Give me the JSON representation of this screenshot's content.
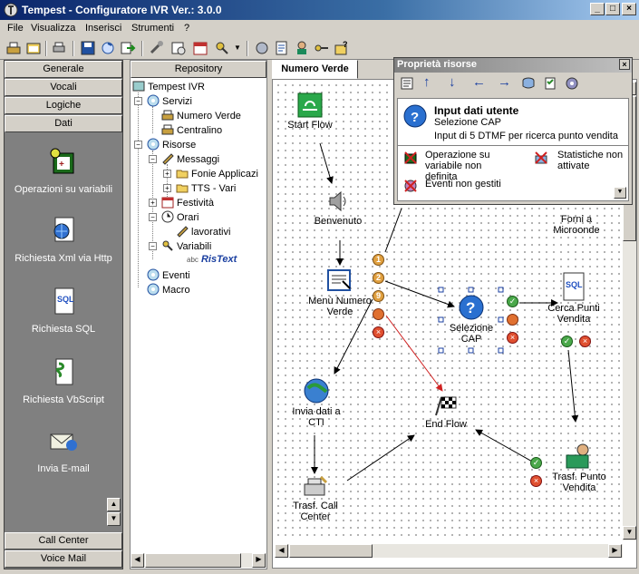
{
  "window": {
    "title": "Tempest - Configuratore IVR Ver.: 3.0.0"
  },
  "menu": [
    "File",
    "Visualizza",
    "Inserisci",
    "Strumenti",
    "?"
  ],
  "left_panel": {
    "categories_top": [
      "Generale",
      "Vocali",
      "Logiche",
      "Dati"
    ],
    "items": [
      "Operazioni su variabili",
      "Richiesta Xml via Http",
      "Richiesta SQL",
      "Richiesta VbScript",
      "Invia E-mail"
    ],
    "categories_bottom": [
      "Call Center",
      "Voice Mail"
    ]
  },
  "repository": {
    "header": "Repository",
    "nodes": {
      "root": "Tempest IVR",
      "servizi": "Servizi",
      "numero_verde": "Numero Verde",
      "centralino": "Centralino",
      "risorse": "Risorse",
      "messaggi": "Messaggi",
      "fonie": "Fonie Applicazi",
      "tts": "TTS - Vari",
      "festivita": "Festività",
      "orari": "Orari",
      "lavorativi": "lavorativi",
      "variabili": "Variabili",
      "ristext": "RisText",
      "ristext_prefix": "abc",
      "eventi": "Eventi",
      "macro": "Macro"
    }
  },
  "canvas": {
    "tab": "Numero Verde",
    "nodes": {
      "start": "Start Flow",
      "benvenuto": "Benvenuto",
      "menu": "Menù Numero Verde",
      "selezione": "Selezione CAP",
      "cerca": "Cerca Punti Vendita",
      "forni": "Forni a Microonde",
      "invia": "Invia dati a CTI",
      "end": "End Flow",
      "trasf_call": "Trasf. Call Center",
      "trasf_punto": "Trasf. Punto Vendita"
    },
    "choices": [
      "1",
      "2",
      "9"
    ]
  },
  "properties": {
    "title": "Proprietà risorse",
    "heading": "Input dati utente",
    "name": "Selezione CAP",
    "description": "Input di 5 DTMF per ricerca punto vendita",
    "warnings": [
      "Operazione su variabile non definita",
      "Statistiche non attivate",
      "Eventi non gestiti"
    ]
  },
  "colors": {
    "title_bar": "#0a246a",
    "panel_gray": "#808080",
    "face": "#d4d0c8",
    "link_red": "#d02020",
    "accent_blue": "#1a3fa0"
  }
}
